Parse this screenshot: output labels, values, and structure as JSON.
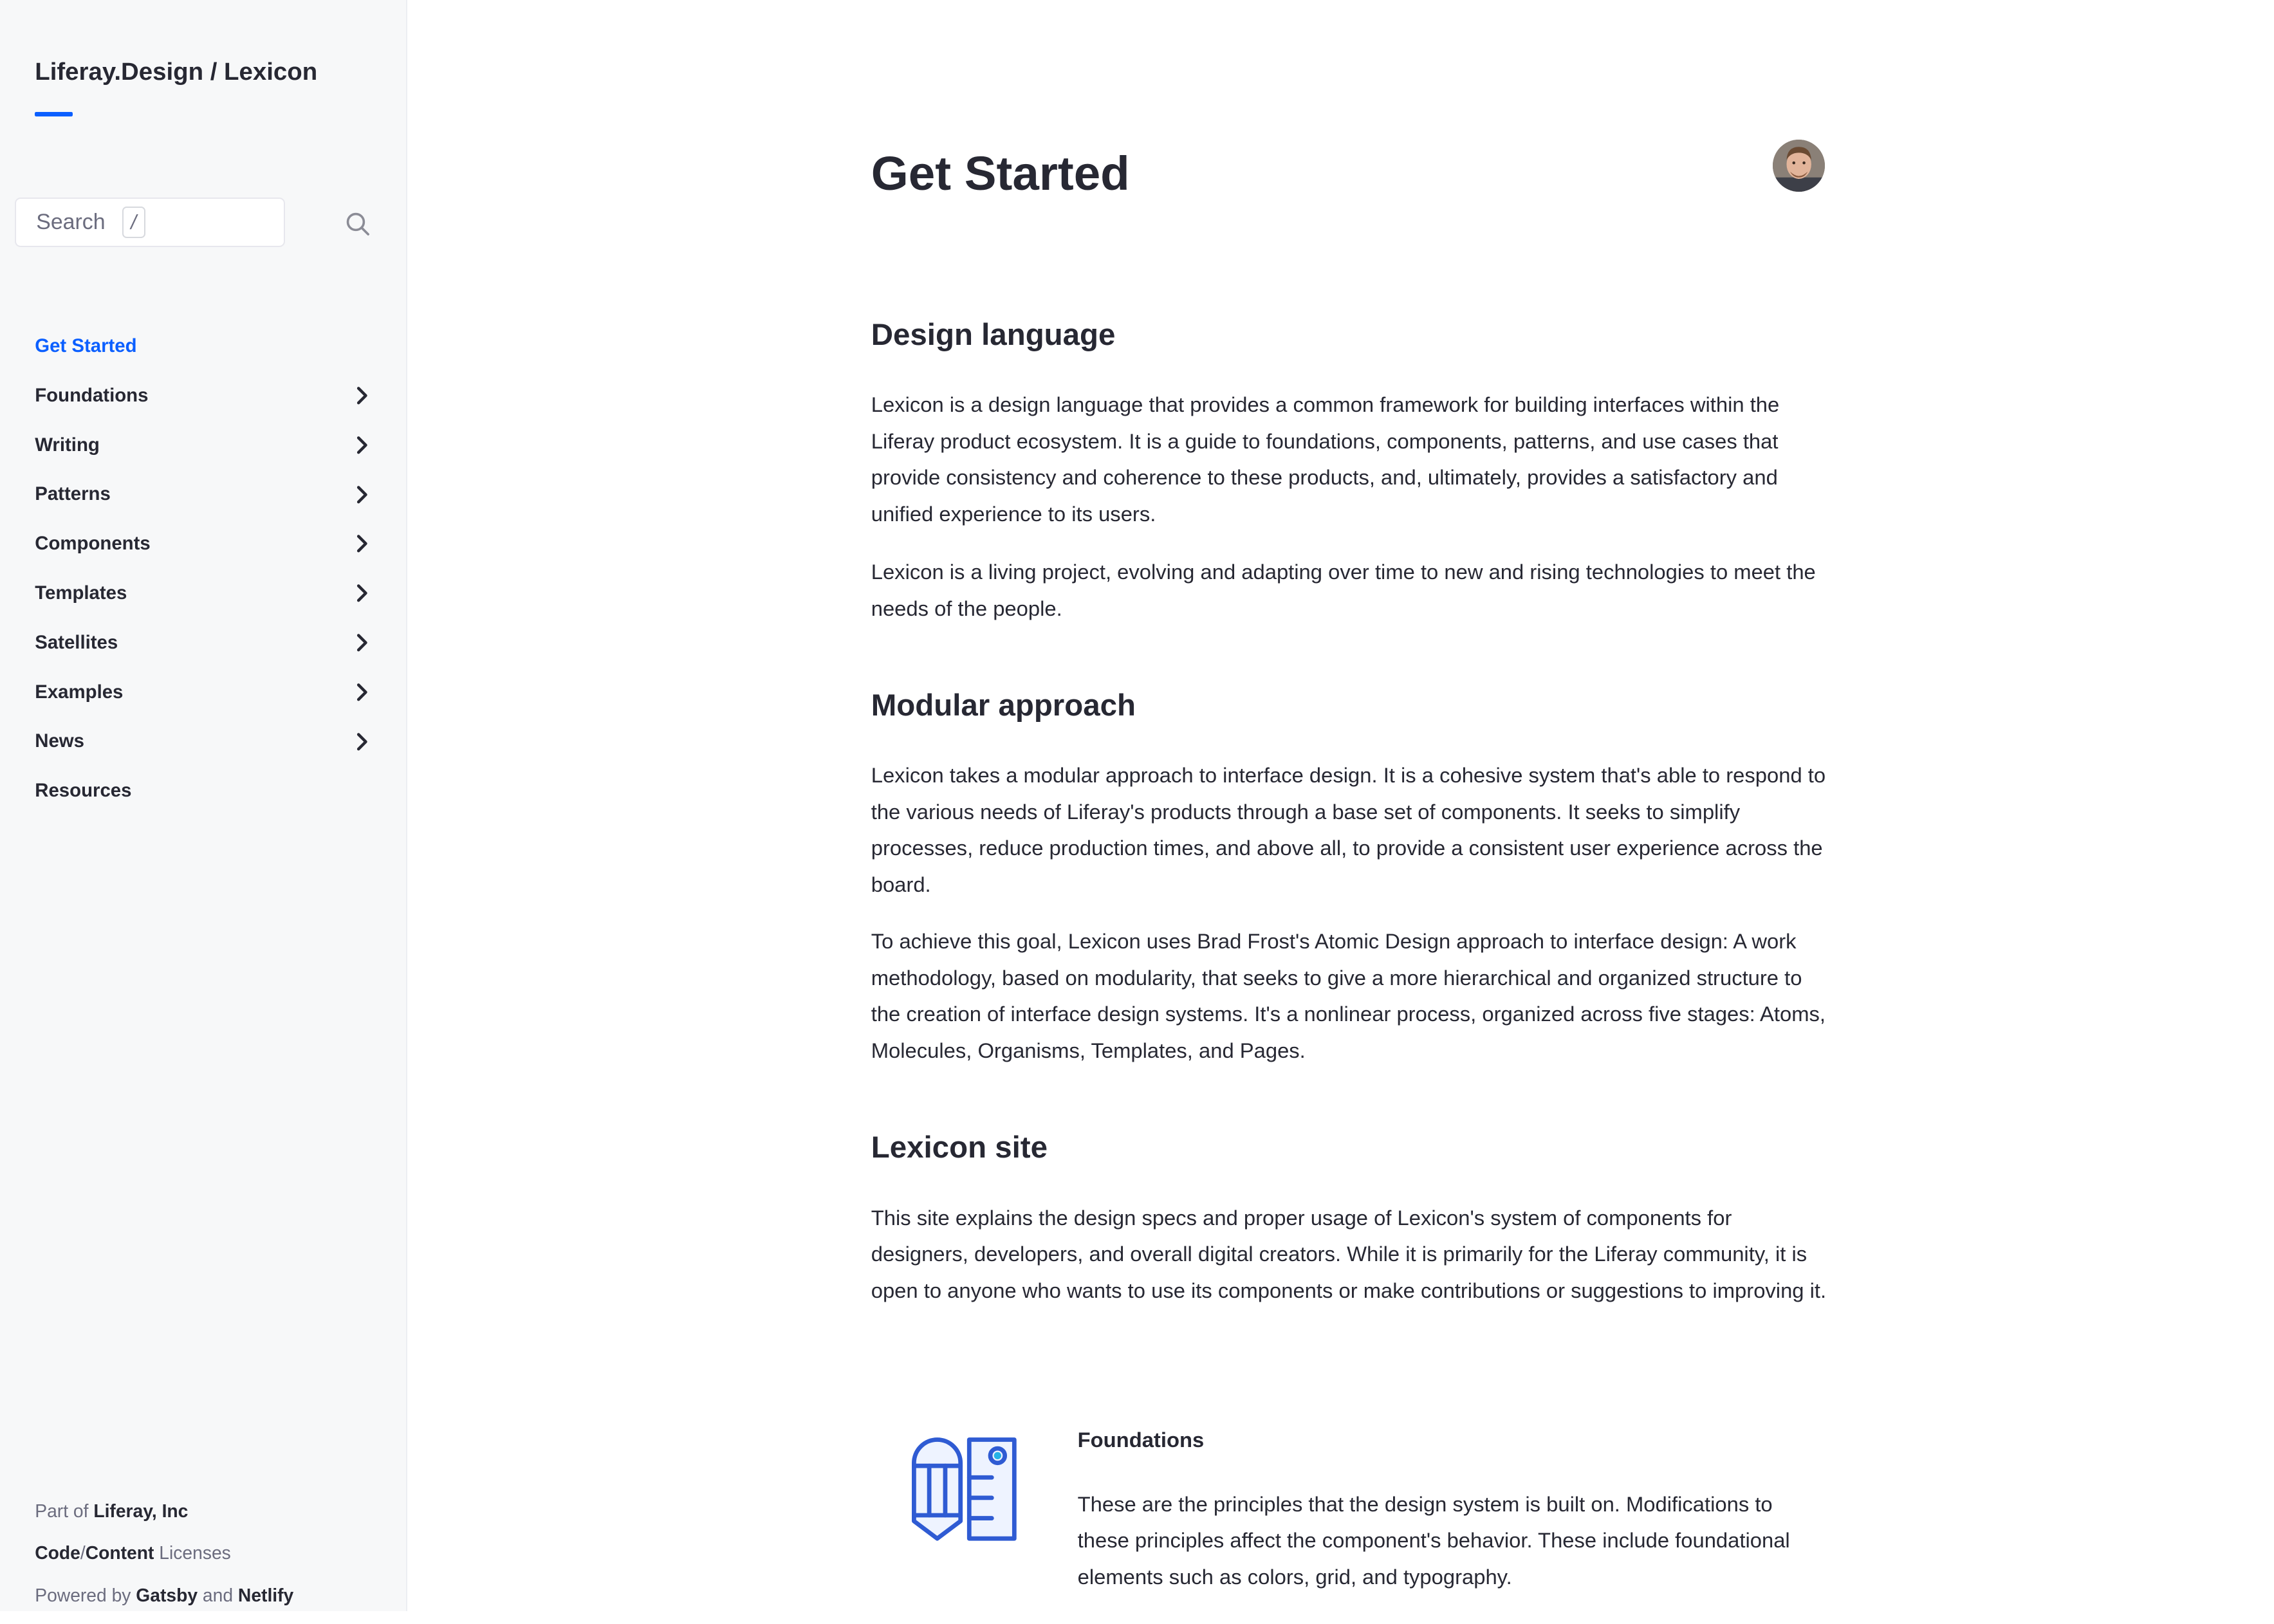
{
  "sidebar": {
    "brand": "Liferay.Design / Lexicon",
    "search": {
      "placeholder": "Search",
      "shortcut": "/"
    },
    "nav": [
      {
        "label": "Get Started",
        "active": true,
        "expandable": false
      },
      {
        "label": "Foundations",
        "expandable": true
      },
      {
        "label": "Writing",
        "expandable": true
      },
      {
        "label": "Patterns",
        "expandable": true
      },
      {
        "label": "Components",
        "expandable": true
      },
      {
        "label": "Templates",
        "expandable": true
      },
      {
        "label": "Satellites",
        "expandable": true
      },
      {
        "label": "Examples",
        "expandable": true
      },
      {
        "label": "News",
        "expandable": true
      },
      {
        "label": "Resources",
        "expandable": false
      }
    ],
    "footer": {
      "part_of_prefix": "Part of",
      "part_of_link": "Liferay, Inc",
      "code_link": "Code",
      "slash": "/",
      "content_link": "Content",
      "licenses": "Licenses",
      "powered_by": "Powered by",
      "gatsby": "Gatsby",
      "and": "and",
      "netlify": "Netlify"
    }
  },
  "main": {
    "title": "Get Started",
    "sections": [
      {
        "heading": "Design language",
        "paragraphs": [
          "Lexicon is a design language that provides a common framework for building interfaces within the Liferay product ecosystem. It is a guide to foundations, components, patterns, and use cases that provide consistency and coherence to these products, and, ultimately, provides a satisfactory and unified experience to its users.",
          "Lexicon is a living project, evolving and adapting over time to new and rising technologies to meet the needs of the people."
        ]
      },
      {
        "heading": "Modular approach",
        "paragraphs": [
          "Lexicon takes a modular approach to interface design. It is a cohesive system that's able to respond to the various needs of Liferay's products through a base set of components. It seeks to simplify processes, reduce production times, and above all, to provide a consistent user experience across the board.",
          "To achieve this goal, Lexicon uses Brad Frost's Atomic Design approach to interface design: A work methodology, based on modularity, that seeks to give a more hierarchical and organized structure to the creation of interface design systems. It's a nonlinear process, organized across five stages: Atoms, Molecules, Organisms, Templates, and Pages."
        ]
      },
      {
        "heading": "Lexicon site",
        "paragraphs": [
          "This site explains the design specs and proper usage of Lexicon's system of components for designers, developers, and overall digital creators. While it is primarily for the Liferay community, it is open to anyone who wants to use its components or make contributions or suggestions to improving it."
        ]
      }
    ],
    "card": {
      "icon": "pencil-document-icon",
      "title": "Foundations",
      "description": "These are the principles that the design system is built on. Modifications to these principles affect the component's behavior. These include foundational elements such as colors, grid, and typography."
    }
  },
  "colors": {
    "accent": "#0b5fff",
    "text": "#272833",
    "muted": "#6b6c7e",
    "sidebar_bg": "#f7f8f9",
    "icon_blue": "#2e5aac"
  }
}
